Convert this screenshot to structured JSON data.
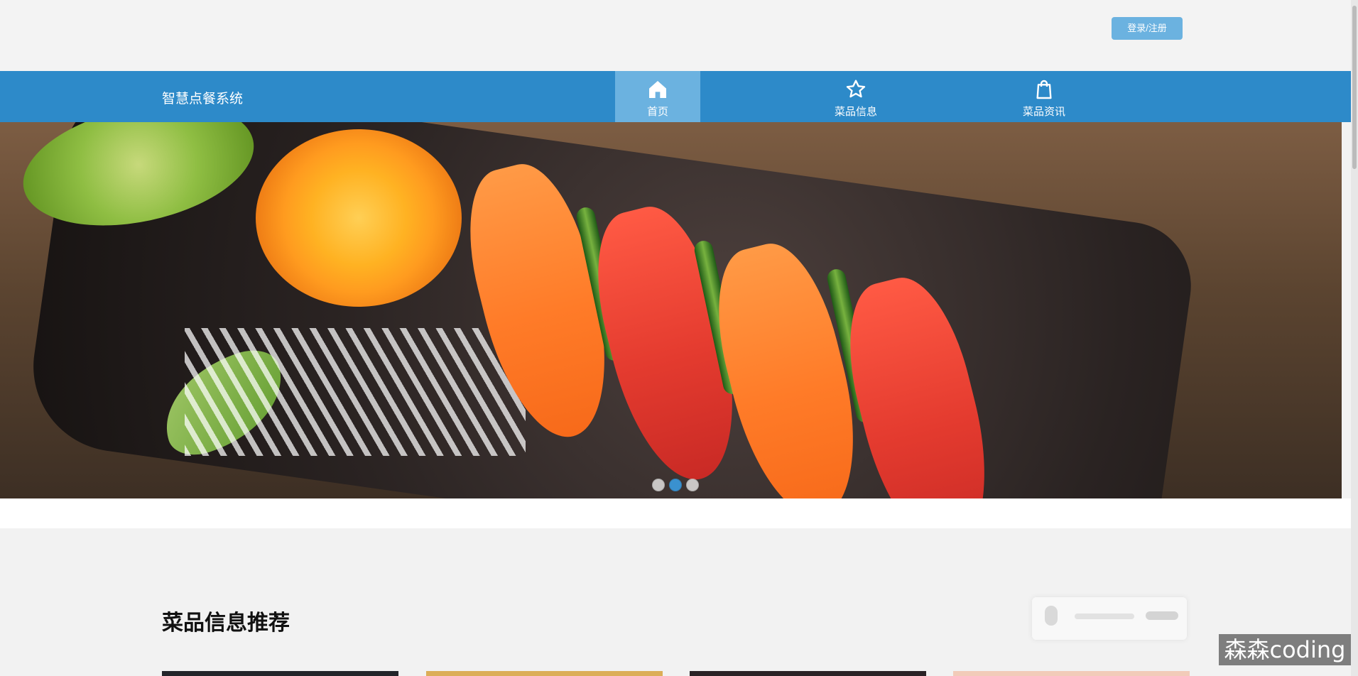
{
  "header": {
    "login_label": "登录/注册"
  },
  "navbar": {
    "brand": "智慧点餐系统",
    "items": [
      {
        "label": "首页",
        "icon": "home-icon"
      },
      {
        "label": "菜品信息",
        "icon": "star-icon"
      },
      {
        "label": "菜品资讯",
        "icon": "shopping-bag-icon"
      }
    ]
  },
  "banner": {
    "active_slide": 2,
    "slide_count": 3
  },
  "section": {
    "title": "菜品信息推荐"
  },
  "watermark": {
    "text": "森森coding"
  }
}
